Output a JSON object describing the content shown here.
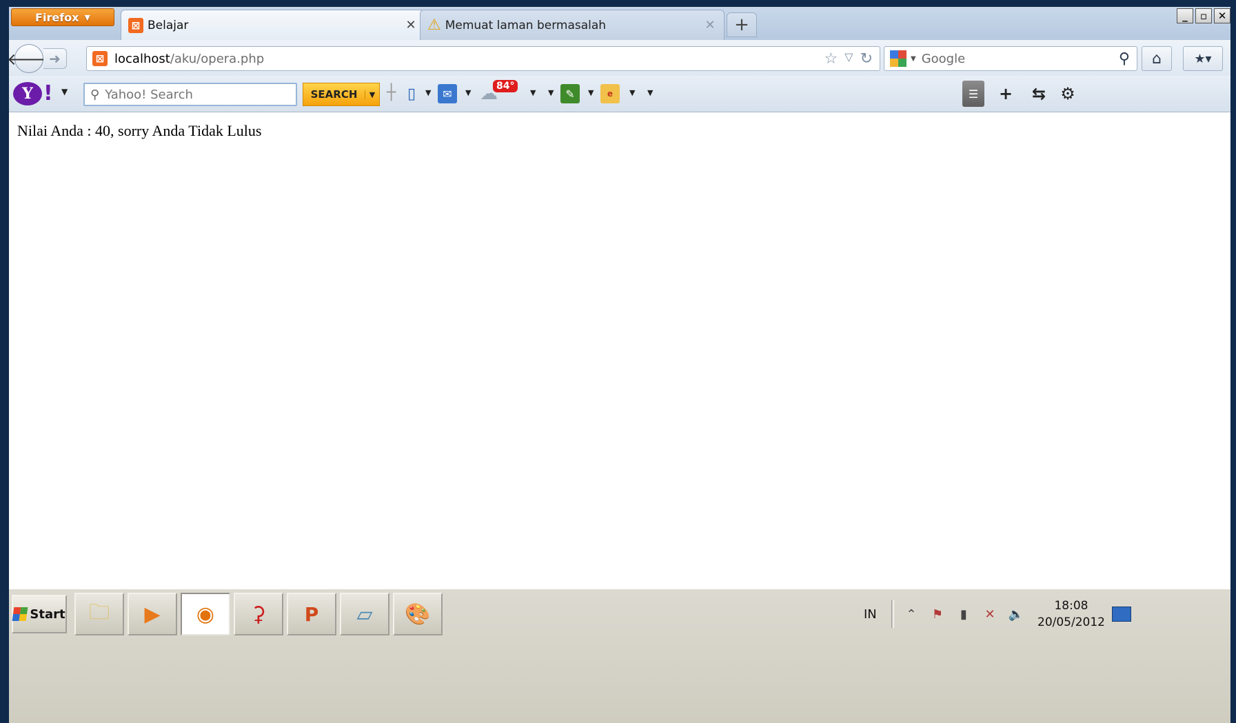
{
  "browser": {
    "menu_button_label": "Firefox",
    "tabs": [
      {
        "title": "Belajar",
        "active": true,
        "favicon": "xampp-icon"
      },
      {
        "title": "Memuat laman bermasalah",
        "active": false,
        "favicon": "warning-icon"
      }
    ],
    "new_tab_label": "+",
    "window_controls": {
      "minimize": "_",
      "maximize": "▫",
      "close": "✕"
    }
  },
  "navbar": {
    "url_host": "localhost",
    "url_path": "/aku/opera.php",
    "search_engine": "Google",
    "search_placeholder": "Google"
  },
  "yahoo_toolbar": {
    "logo_text": "Y",
    "search_placeholder": "Yahoo! Search",
    "search_button": "SEARCH",
    "weather_badge": "84°"
  },
  "content": {
    "result_text": "Nilai Anda : 40, sorry Anda Tidak Lulus"
  },
  "taskbar": {
    "start_label": "Start",
    "language": "IN",
    "time": "18:08",
    "date": "20/05/2012"
  },
  "colors": {
    "firefox_orange": "#e2730c",
    "yahoo_purple": "#6b1ca8",
    "search_yellow": "#f5a20c",
    "weather_red": "#e01d1d"
  }
}
